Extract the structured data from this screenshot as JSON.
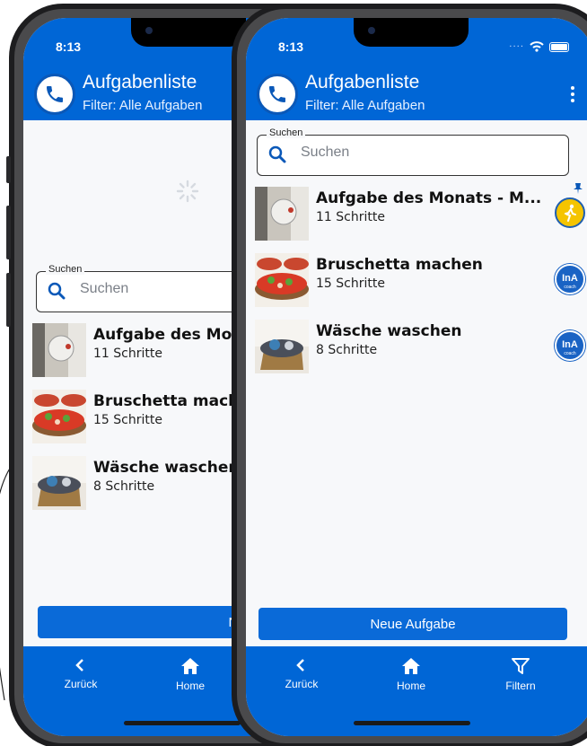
{
  "back_phone": {
    "status_time": "8:13",
    "app_title": "Aufgabenliste",
    "app_subtitle": "Filter: Alle Aufgaben",
    "search_label": "Suchen",
    "search_placeholder": "Suchen",
    "tasks": [
      {
        "title": "Aufgabe des Monats",
        "steps": "11 Schritte"
      },
      {
        "title": "Bruschetta machen",
        "steps": "15 Schritte"
      },
      {
        "title": "Wäsche waschen",
        "steps": "8 Schritte"
      }
    ],
    "new_task_label": "Neue Aufgabe",
    "nav": {
      "back": "Zurück",
      "home": "Home"
    }
  },
  "front_phone": {
    "status_time": "8:13",
    "app_title": "Aufgabenliste",
    "app_subtitle": "Filter: Alle Aufgaben",
    "search_label": "Suchen",
    "search_placeholder": "Suchen",
    "tasks": [
      {
        "title": "Aufgabe des Monats - M...",
        "steps": "11 Schritte",
        "badge": "task-of-month",
        "pinned": true
      },
      {
        "title": "Bruschetta machen",
        "steps": "15 Schritte",
        "badge": "ina-coach",
        "badge_text": "InA",
        "badge_sub": "coach"
      },
      {
        "title": "Wäsche waschen",
        "steps": "8 Schritte",
        "badge": "ina-coach",
        "badge_text": "InA",
        "badge_sub": "coach"
      }
    ],
    "new_task_label": "Neue Aufgabe",
    "nav": {
      "back": "Zurück",
      "home": "Home",
      "filter": "Filtern"
    }
  },
  "colors": {
    "primary": "#0066d6",
    "button": "#0a6ad8",
    "background": "#f7f8fa",
    "badge_yellow": "#f5c400"
  },
  "icons": [
    "phone-icon",
    "search-icon",
    "pin-icon",
    "chevron-left-icon",
    "home-icon",
    "filter-icon",
    "more-vert-icon",
    "wifi-icon",
    "battery-icon",
    "spinner-icon"
  ]
}
